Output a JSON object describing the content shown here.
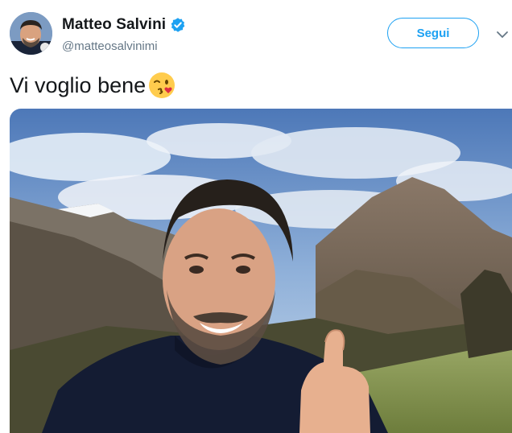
{
  "tweet": {
    "author_name": "Matteo Salvini",
    "author_handle": "@matteosalvinimi",
    "follow_label": "Segui",
    "text": "Vi voglio bene",
    "emoji": "kissing-winking-face-icon",
    "photo": "selfie-mountains-photo"
  },
  "colors": {
    "accent": "#1da1f2",
    "name": "#14171a",
    "handle": "#657786"
  }
}
